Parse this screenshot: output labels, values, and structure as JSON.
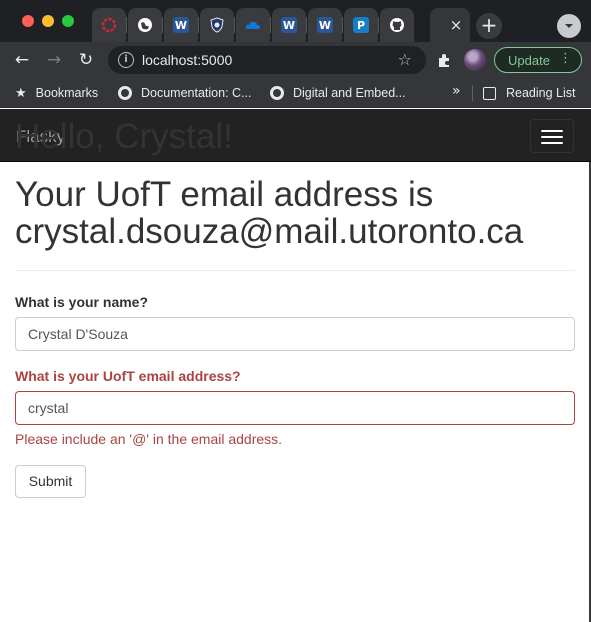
{
  "browser": {
    "tabs": [
      {
        "icon": "opera-icon",
        "color": "#e0242f"
      },
      {
        "icon": "globe-icon",
        "color": "#ffffff"
      },
      {
        "icon": "word-icon",
        "color": "#2b579a",
        "glyph": "W"
      },
      {
        "icon": "shield-icon",
        "color": "#1e3a6e"
      },
      {
        "icon": "onedrive-icon",
        "color": "#0f78d4"
      },
      {
        "icon": "word-icon",
        "color": "#2b579a",
        "glyph": "W"
      },
      {
        "icon": "word-icon",
        "color": "#2b579a",
        "glyph": "W"
      },
      {
        "icon": "p-icon",
        "color": "#1581c4",
        "glyph": "P"
      },
      {
        "icon": "github-icon",
        "color": "#ffffff"
      }
    ],
    "active_tab_close": "×",
    "new_tab": "+",
    "url": "localhost:5000",
    "update_label": "Update",
    "bookmarks": [
      {
        "label": "Bookmarks",
        "icon": "star-icon"
      },
      {
        "label": "Documentation: C...",
        "icon": "globe-icon"
      },
      {
        "label": "Digital and Embed...",
        "icon": "globe-icon"
      }
    ],
    "overflow": "»",
    "reading_list": "Reading List"
  },
  "navbar": {
    "brand": "Flasky"
  },
  "main": {
    "greeting": "Hello, Crystal!",
    "email_line1": "Your UofT email address is",
    "email_line2": "crystal.dsouza@mail.utoronto.ca"
  },
  "form": {
    "name_label": "What is your name?",
    "name_value": "Crystal D'Souza",
    "email_label": "What is your UofT email address?",
    "email_value": "crystal",
    "email_error": "Please include an '@' in the email address.",
    "submit_label": "Submit"
  },
  "colors": {
    "error": "#a94442",
    "navbar_bg": "#222222",
    "update_accent": "#81c995"
  }
}
